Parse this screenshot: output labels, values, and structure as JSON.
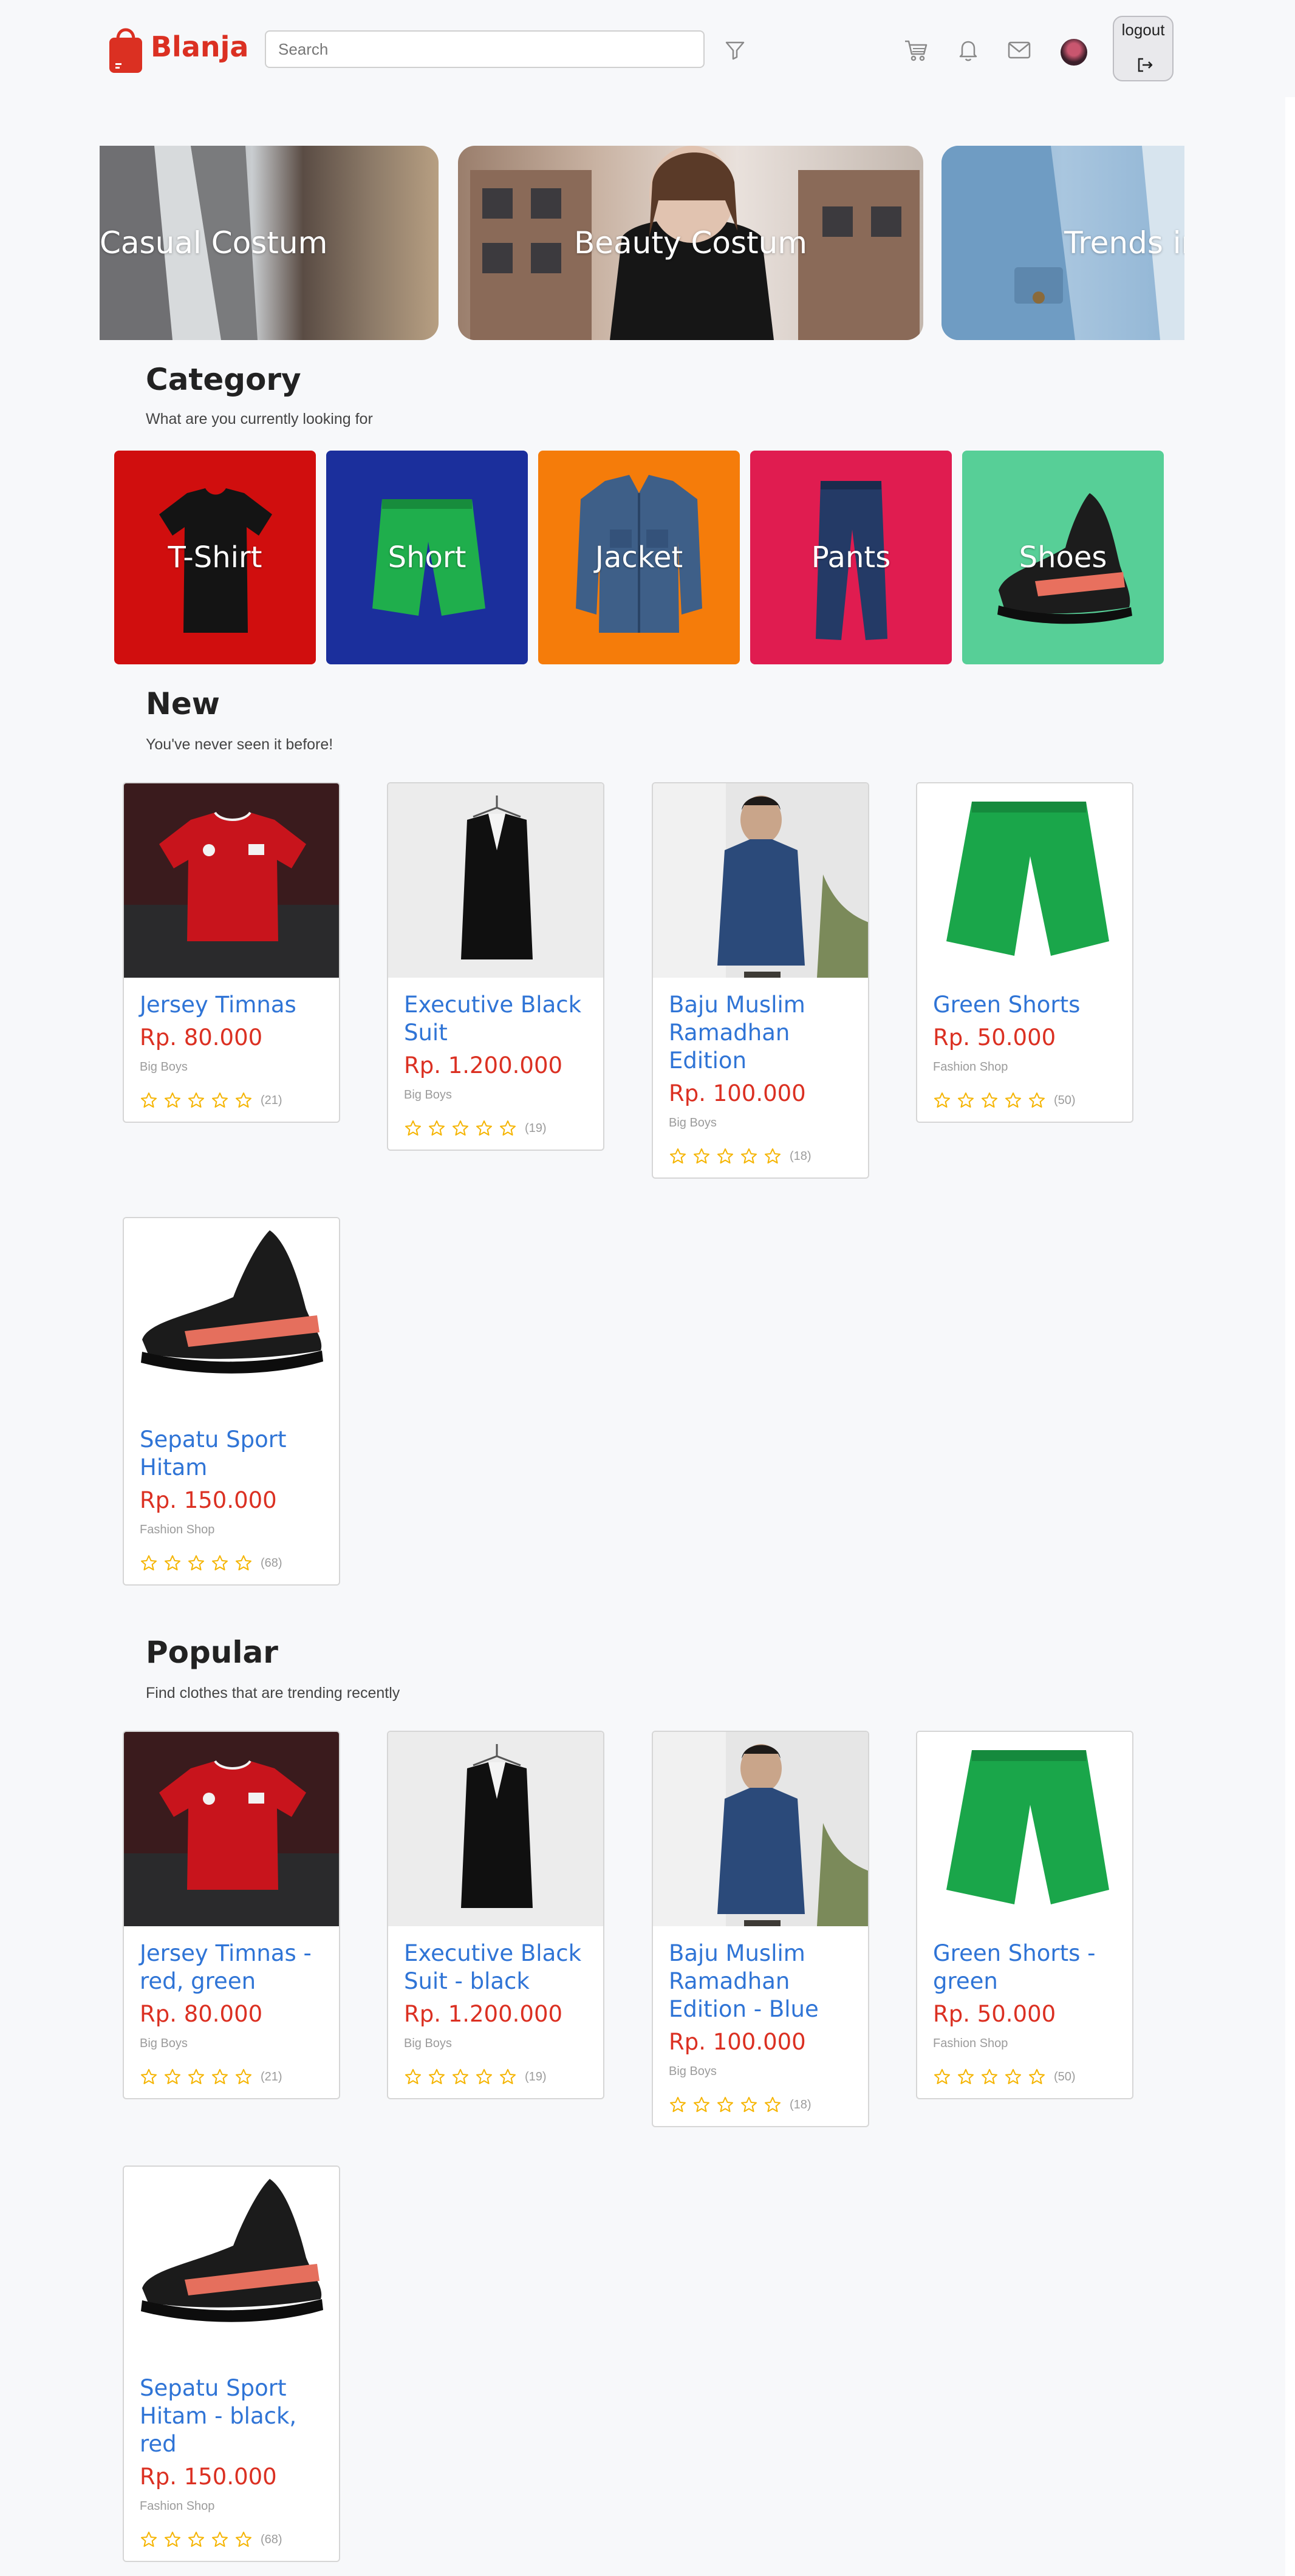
{
  "brand": {
    "name": "Blanja"
  },
  "search": {
    "placeholder": "Search"
  },
  "nav": {
    "logout_label": "logout"
  },
  "colors": {
    "accent": "#db3022",
    "link": "#2f74d6",
    "star": "#f5b400"
  },
  "carousel": [
    {
      "title": "Casual Costum"
    },
    {
      "title": "Beauty Costum"
    },
    {
      "title": "Trends in"
    }
  ],
  "category": {
    "title": "Category",
    "subtitle": "What are you currently looking for",
    "items": [
      {
        "label": "T-Shirt",
        "color": "#d00e0e"
      },
      {
        "label": "Short",
        "color": "#1b2f9c"
      },
      {
        "label": "Jacket",
        "color": "#f57c0a"
      },
      {
        "label": "Pants",
        "color": "#e01c50"
      },
      {
        "label": "Shoes",
        "color": "#57cf97"
      }
    ]
  },
  "new": {
    "title": "New",
    "subtitle": "You've never seen it before!",
    "products": [
      {
        "name": "Jersey Timnas",
        "price": "Rp. 80.000",
        "store": "Big Boys",
        "rating_count": "(21)",
        "image": "red-jersey"
      },
      {
        "name": "Executive Black Suit",
        "price": "Rp. 1.200.000",
        "store": "Big Boys",
        "rating_count": "(19)",
        "image": "black-suit"
      },
      {
        "name": "Baju Muslim Ramadhan Edition",
        "price": "Rp. 100.000",
        "store": "Big Boys",
        "rating_count": "(18)",
        "image": "blue-shirt-man"
      },
      {
        "name": "Green Shorts",
        "price": "Rp. 50.000",
        "store": "Fashion Shop",
        "rating_count": "(50)",
        "image": "green-shorts"
      },
      {
        "name": "Sepatu Sport Hitam",
        "price": "Rp. 150.000",
        "store": "Fashion Shop",
        "rating_count": "(68)",
        "image": "black-sneaker"
      }
    ]
  },
  "popular": {
    "title": "Popular",
    "subtitle": "Find clothes that are trending recently",
    "products": [
      {
        "name": "Jersey Timnas - red, green",
        "price": "Rp. 80.000",
        "store": "Big Boys",
        "rating_count": "(21)",
        "image": "red-jersey"
      },
      {
        "name": "Executive Black Suit - black",
        "price": "Rp. 1.200.000",
        "store": "Big Boys",
        "rating_count": "(19)",
        "image": "black-suit"
      },
      {
        "name": "Baju Muslim Ramadhan Edition - Blue",
        "price": "Rp. 100.000",
        "store": "Big Boys",
        "rating_count": "(18)",
        "image": "blue-shirt-man"
      },
      {
        "name": "Green Shorts - green",
        "price": "Rp. 50.000",
        "store": "Fashion Shop",
        "rating_count": "(50)",
        "image": "green-shorts"
      },
      {
        "name": "Sepatu Sport Hitam - black, red",
        "price": "Rp. 150.000",
        "store": "Fashion Shop",
        "rating_count": "(68)",
        "image": "black-sneaker"
      }
    ]
  }
}
